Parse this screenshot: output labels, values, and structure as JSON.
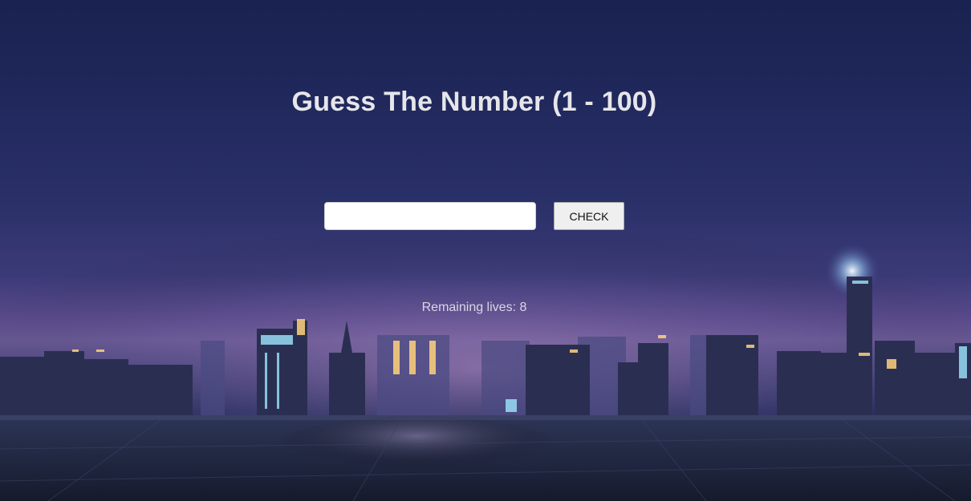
{
  "header": {
    "title": "Guess The Number (1 - 100)"
  },
  "form": {
    "input_value": "",
    "input_placeholder": "",
    "check_label": "CHECK"
  },
  "status": {
    "lives_text": "Remaining lives: 8"
  },
  "background": {
    "description_icon": "night-city-skyline",
    "sky_color": "#1f275a",
    "glow_color": "#8a6aa8",
    "floor_color": "#1c2238"
  }
}
